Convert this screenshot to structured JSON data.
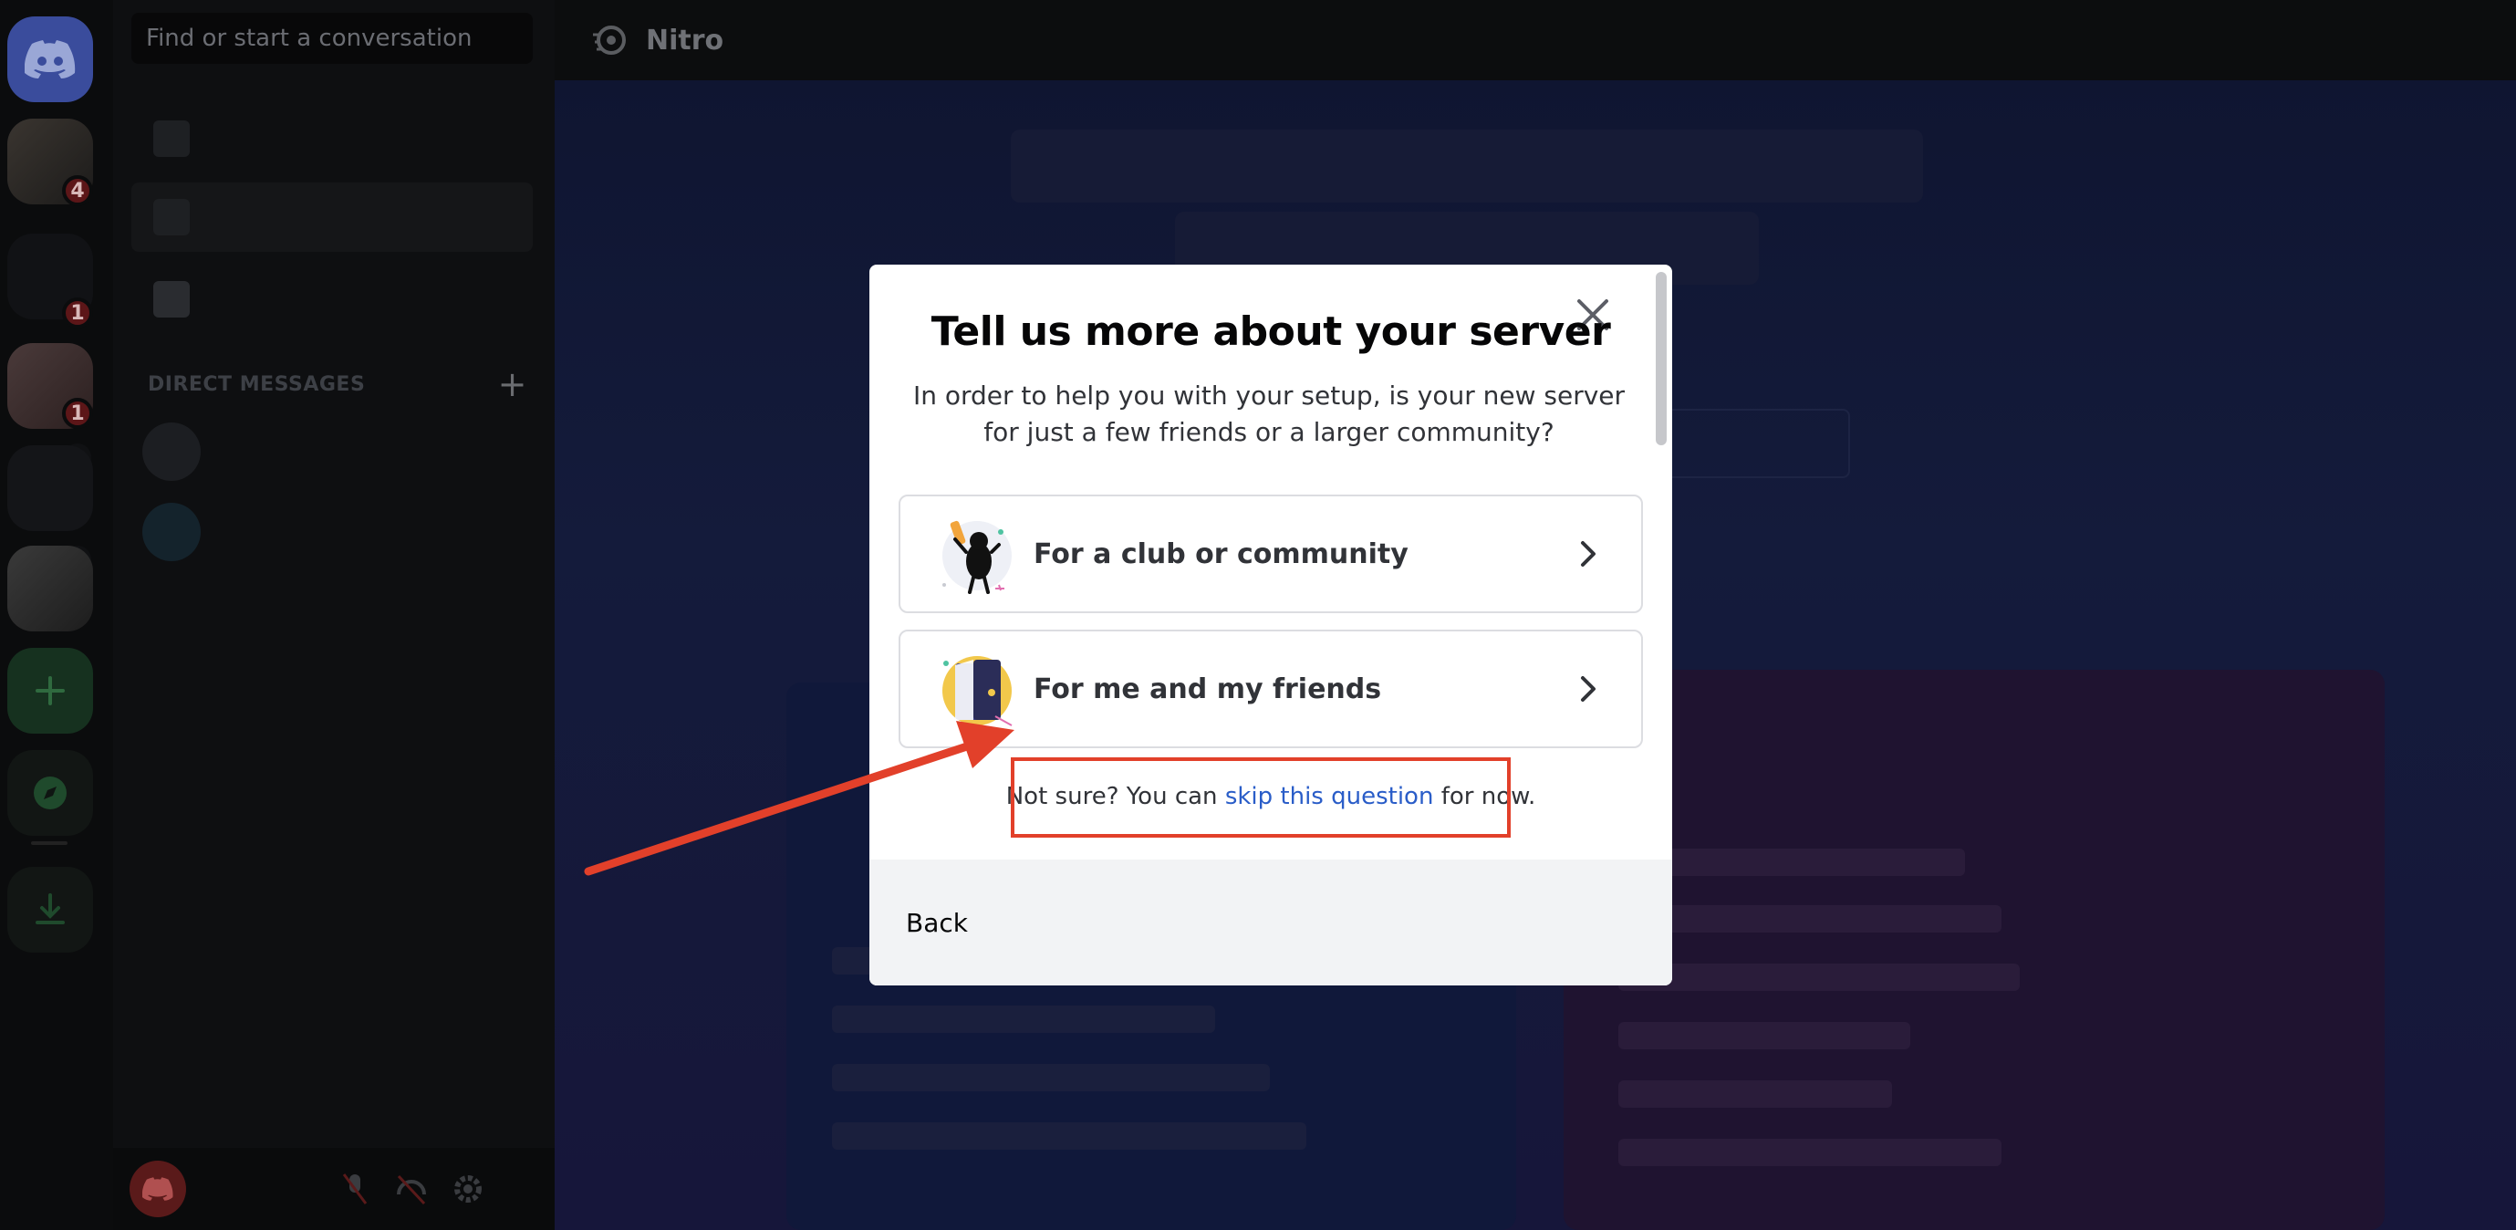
{
  "search": {
    "placeholder": "Find or start a conversation"
  },
  "topbar": {
    "title": "Nitro"
  },
  "sidebar": {
    "dm_header": "DIRECT MESSAGES",
    "badges": [
      "4",
      "1",
      "1"
    ]
  },
  "modal": {
    "title": "Tell us more about your server",
    "description": "In order to help you with your setup, is your new server for just a few friends or a larger community?",
    "options": [
      {
        "label": "For a club or community",
        "icon": "club-community-icon"
      },
      {
        "label": "For me and my friends",
        "icon": "friends-icon"
      }
    ],
    "skip": {
      "prefix": "Not sure? You can ",
      "link": "skip this question",
      "suffix": " for now."
    },
    "back_label": "Back"
  },
  "colors": {
    "annotation": "#e2402a",
    "link": "#2a5dc8",
    "modal_bg": "#ffffff",
    "footer_bg": "#f2f3f5"
  }
}
